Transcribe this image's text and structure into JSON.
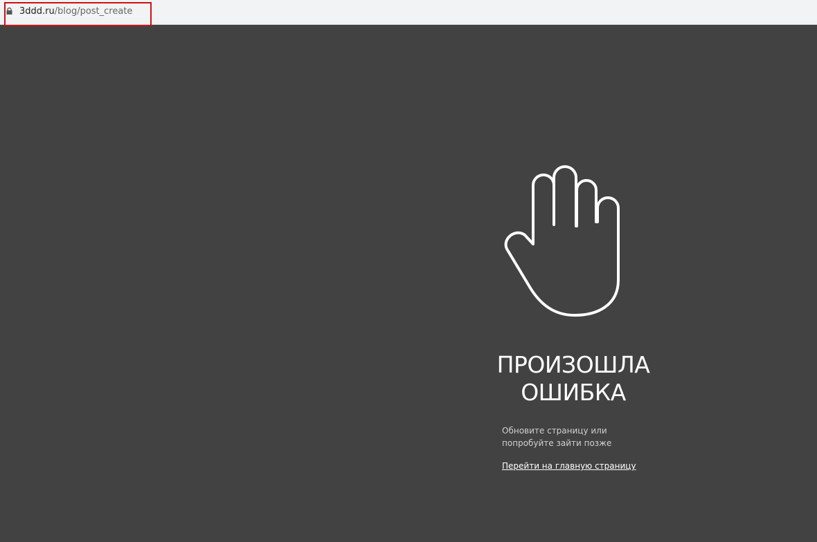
{
  "browser": {
    "url_domain": "3ddd.ru",
    "url_path": "/blog/post_create",
    "highlight_color": "#cc1111"
  },
  "error": {
    "icon": "hand-stop-icon",
    "title_line1": "ПРОИЗОШЛА",
    "title_line2": "ОШИБКА",
    "message": "Обновите страницу или попробуйте зайти позже",
    "home_link": "Перейти на главную страницу"
  },
  "colors": {
    "background": "#424242",
    "text": "#ffffff"
  }
}
